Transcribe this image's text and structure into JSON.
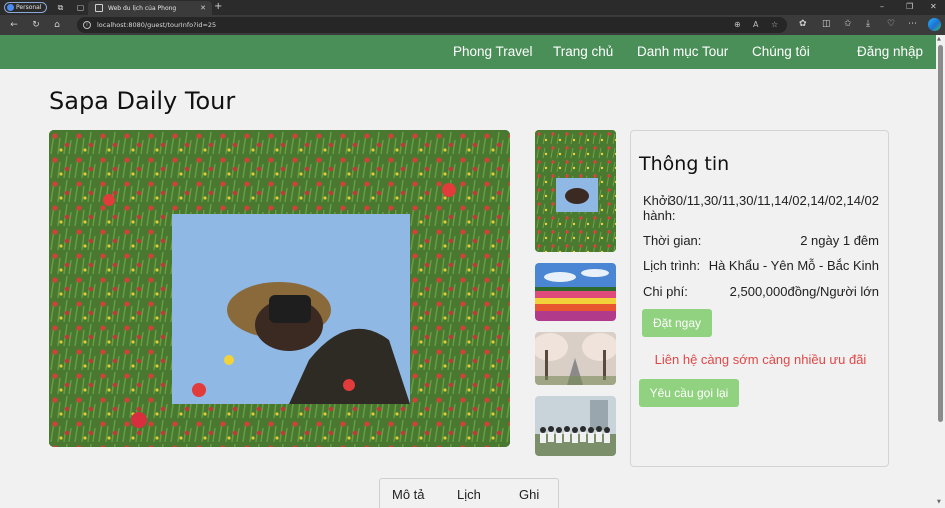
{
  "browser": {
    "profile_label": "Personal",
    "tab_title": "Web du lịch của Phong",
    "url": "localhost:8080/guest/tourInfo?id=25",
    "new_tab_symbol": "+",
    "icons": [
      "workspaces-icon",
      "tab-actions-icon",
      "back-icon",
      "refresh-icon",
      "home-icon",
      "zoom-icon",
      "read-aloud-icon",
      "favorite-icon",
      "extensions-icon",
      "split-screen-icon",
      "favorites-icon",
      "downloads-icon",
      "browser-essentials-icon",
      "settings-more-icon",
      "copilot-icon"
    ]
  },
  "nav": {
    "brand": "Phong Travel",
    "home": "Trang chủ",
    "tour_catalog": "Danh mục Tour",
    "about": "Chúng tôi",
    "login": "Đăng nhập"
  },
  "tour": {
    "title": "Sapa Daily Tour"
  },
  "info": {
    "heading": "Thông tin",
    "departure_label": "Khởi hành:",
    "departure_value": "30/11,30/11,30/11,14/02,14/02,14/02",
    "duration_label": "Thời gian:",
    "duration_value": "2 ngày 1 đêm",
    "itinerary_label": "Lịch trình:",
    "itinerary_value": "Hà Khẩu - Yên Mỗ - Bắc Kinh",
    "price_label": "Chi phí:",
    "price_value": "2,500,000đồng/Người lớn",
    "book_button": "Đặt ngay",
    "promo_text": "Liên hệ càng sớm càng nhiều ưu đãi",
    "callback_button": "Yêu cầu gọi lại"
  },
  "detail_tabs": {
    "description": "Mô tả",
    "schedule": "Lịch",
    "note": "Ghi"
  },
  "colors": {
    "navbar": "#4a8f57",
    "button": "#90d27f",
    "promo": "#e04848"
  }
}
